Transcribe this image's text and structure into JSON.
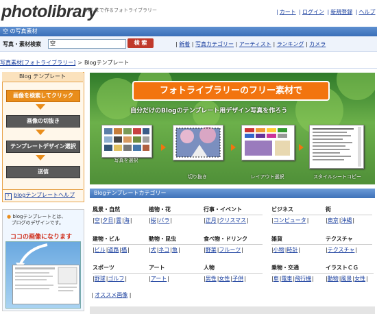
{
  "header": {
    "logo": "photolibrary",
    "tagline": "みんなで作るフォトライブラリー",
    "top_links": [
      "カート",
      "ログイン",
      "新規登録",
      "ヘルプ"
    ]
  },
  "search": {
    "section_title": "空 の写真素材",
    "label": "写真・素材検索",
    "value": "空",
    "button": "検 索",
    "links": [
      "新着",
      "写真カテゴリー",
      "アーティスト",
      "ランキング",
      "カメラ"
    ]
  },
  "breadcrumb": {
    "parent": "写真素材[フォトライブラリー]",
    "separator": ">",
    "current": "Blogテンプレート"
  },
  "left_panel": {
    "title": "Blog テンプレート",
    "steps": [
      "画像を検索してクリック",
      "画像の切抜き",
      "テンプレートデザイン選択",
      "送信"
    ],
    "help_link": "blogテンプレートヘルプ",
    "promo_line1": "blogテンプレートとは、",
    "promo_line2": "ブログのデザインです。",
    "promo_red": "ココの画像になります"
  },
  "banner": {
    "title": "フォトライブラリーのフリー素材で",
    "subtitle": "自分だけのBlogのテンプレート用デザイン写真を作ろう",
    "captions": [
      "写真を選択",
      "切り抜き",
      "レイアウト選択",
      "スタイルシートコピー"
    ]
  },
  "categories": {
    "title": "Blogテンプレートカテゴリー",
    "items": [
      {
        "name": "風景・自然",
        "links": [
          "空",
          "夕日",
          "雲",
          "海"
        ]
      },
      {
        "name": "植物・花",
        "links": [
          "桜",
          "バラ"
        ]
      },
      {
        "name": "行事・イベント",
        "links": [
          "正月",
          "クリスマス"
        ]
      },
      {
        "name": "ビジネス",
        "links": [
          "コンピュータ"
        ]
      },
      {
        "name": "街",
        "links": [
          "東京",
          "沖縄"
        ]
      },
      {
        "name": "建物・ビル",
        "links": [
          "ビル",
          "道路",
          "橋"
        ]
      },
      {
        "name": "動物・昆虫",
        "links": [
          "犬",
          "ネコ",
          "魚"
        ]
      },
      {
        "name": "食べ物・ドリンク",
        "links": [
          "野菜",
          "フルーツ"
        ]
      },
      {
        "name": "雑貨",
        "links": [
          "小物",
          "時計"
        ]
      },
      {
        "name": "テクスチャ",
        "links": [
          "テクスチャ"
        ]
      },
      {
        "name": "スポーツ",
        "links": [
          "野球",
          "ゴルフ"
        ]
      },
      {
        "name": "アート",
        "links": [
          "アート"
        ]
      },
      {
        "name": "人物",
        "links": [
          "男性",
          "女性",
          "子供"
        ]
      },
      {
        "name": "乗物・交通",
        "links": [
          "車",
          "電車",
          "飛行機"
        ]
      },
      {
        "name": "イラストＣＧ",
        "links": [
          "動物",
          "風景",
          "女性"
        ]
      }
    ],
    "recommended": "オススメ画像"
  }
}
